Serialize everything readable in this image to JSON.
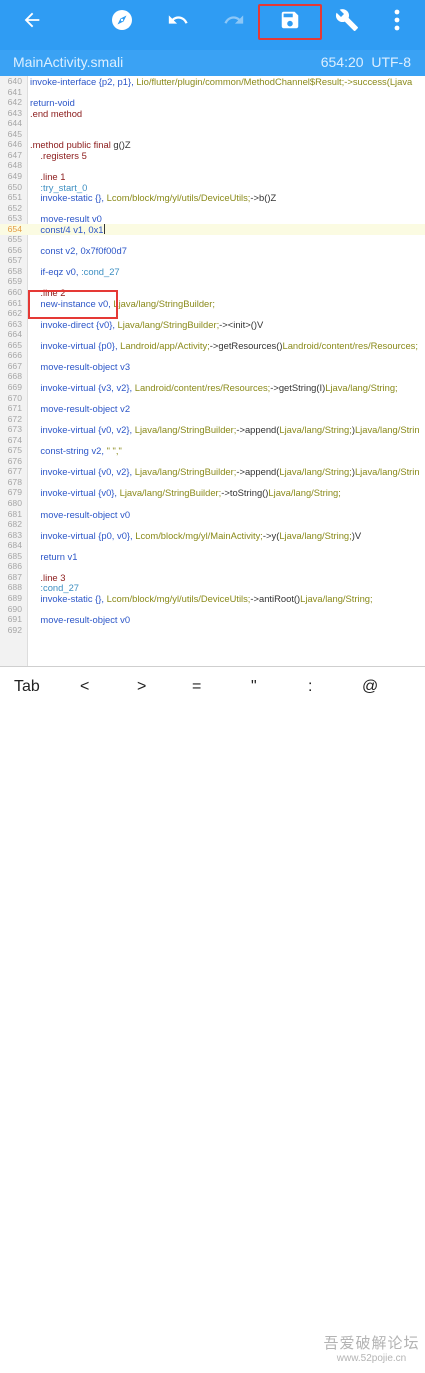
{
  "colors": {
    "toolbar": "#2f9cf3",
    "filebar": "#3aa2f4",
    "highlight": "#e53935",
    "keyword": "#2c56c8",
    "directive": "#8b1a1a",
    "label": "#3d8fc2",
    "type": "#8a8a1a"
  },
  "toolbar": {
    "icons": [
      "back-arrow-icon",
      "compass-icon",
      "undo-icon",
      "redo-icon",
      "save-icon",
      "wrench-icon",
      "more-vert-icon"
    ]
  },
  "file": {
    "name": "MainActivity.smali",
    "position": "654:20",
    "encoding": "UTF-8"
  },
  "lines": [
    {
      "num": "640",
      "tokens": [
        [
          "k-kw",
          "invoke-interface {p2, p1}, "
        ],
        [
          "k-str",
          "Lio/flutter/plugin/common/MethodChannel$Result;->success(Ljava"
        ]
      ]
    },
    {
      "num": "641",
      "tokens": []
    },
    {
      "num": "642",
      "tokens": [
        [
          "k-kw",
          "return-void"
        ]
      ]
    },
    {
      "num": "643",
      "tokens": [
        [
          "k-dir",
          ".end method"
        ]
      ]
    },
    {
      "num": "644",
      "tokens": []
    },
    {
      "num": "645",
      "tokens": []
    },
    {
      "num": "646",
      "tokens": [
        [
          "k-dir",
          ".method public final "
        ],
        [
          "k-plain",
          "g()Z"
        ]
      ]
    },
    {
      "num": "647",
      "tokens": [
        [
          "k-dir",
          "    .registers 5"
        ]
      ]
    },
    {
      "num": "648",
      "tokens": []
    },
    {
      "num": "649",
      "tokens": [
        [
          "k-dir",
          "    .line 1"
        ]
      ]
    },
    {
      "num": "650",
      "tokens": [
        [
          "k-lbl",
          "    :try_start_0"
        ]
      ]
    },
    {
      "num": "651",
      "tokens": [
        [
          "k-kw",
          "    invoke-static {}, "
        ],
        [
          "k-str",
          "Lcom/block/mg/yl/utils/DeviceUtils;"
        ],
        [
          "k-plain",
          "->b()Z"
        ]
      ]
    },
    {
      "num": "652",
      "tokens": []
    },
    {
      "num": "653",
      "tokens": [
        [
          "k-kw",
          "    move-result v0"
        ]
      ]
    },
    {
      "num": "654",
      "tokens": [
        [
          "k-kw",
          "    const/4 v1, 0x1"
        ]
      ],
      "current": true
    },
    {
      "num": "655",
      "tokens": []
    },
    {
      "num": "656",
      "tokens": [
        [
          "k-kw",
          "    const v2, 0x7f0f00d7"
        ]
      ]
    },
    {
      "num": "657",
      "tokens": []
    },
    {
      "num": "658",
      "tokens": [
        [
          "k-kw",
          "    if-eqz v0, "
        ],
        [
          "k-lbl",
          ":cond_27"
        ]
      ]
    },
    {
      "num": "659",
      "tokens": []
    },
    {
      "num": "660",
      "tokens": [
        [
          "k-dir",
          "    .line 2"
        ]
      ]
    },
    {
      "num": "661",
      "tokens": [
        [
          "k-kw",
          "    new-instance v0, "
        ],
        [
          "k-str",
          "Ljava/lang/StringBuilder;"
        ]
      ]
    },
    {
      "num": "662",
      "tokens": []
    },
    {
      "num": "663",
      "tokens": [
        [
          "k-kw",
          "    invoke-direct {v0}, "
        ],
        [
          "k-str",
          "Ljava/lang/StringBuilder;"
        ],
        [
          "k-plain",
          "-><init>()V"
        ]
      ]
    },
    {
      "num": "664",
      "tokens": []
    },
    {
      "num": "665",
      "tokens": [
        [
          "k-kw",
          "    invoke-virtual {p0}, "
        ],
        [
          "k-str",
          "Landroid/app/Activity;"
        ],
        [
          "k-plain",
          "->getResources()"
        ],
        [
          "k-str",
          "Landroid/content/res/Resources;"
        ]
      ]
    },
    {
      "num": "666",
      "tokens": []
    },
    {
      "num": "667",
      "tokens": [
        [
          "k-kw",
          "    move-result-object v3"
        ]
      ]
    },
    {
      "num": "668",
      "tokens": []
    },
    {
      "num": "669",
      "tokens": [
        [
          "k-kw",
          "    invoke-virtual {v3, v2}, "
        ],
        [
          "k-str",
          "Landroid/content/res/Resources;"
        ],
        [
          "k-plain",
          "->getString(I)"
        ],
        [
          "k-str",
          "Ljava/lang/String;"
        ]
      ]
    },
    {
      "num": "670",
      "tokens": []
    },
    {
      "num": "671",
      "tokens": [
        [
          "k-kw",
          "    move-result-object v2"
        ]
      ]
    },
    {
      "num": "672",
      "tokens": []
    },
    {
      "num": "673",
      "tokens": [
        [
          "k-kw",
          "    invoke-virtual {v0, v2}, "
        ],
        [
          "k-str",
          "Ljava/lang/StringBuilder;"
        ],
        [
          "k-plain",
          "->append("
        ],
        [
          "k-str",
          "Ljava/lang/String;"
        ],
        [
          "k-plain",
          ")"
        ],
        [
          "k-str",
          "Ljava/lang/Strin"
        ]
      ]
    },
    {
      "num": "674",
      "tokens": []
    },
    {
      "num": "675",
      "tokens": [
        [
          "k-kw",
          "    const-string v2, "
        ],
        [
          "k-str",
          "\" \",\""
        ]
      ]
    },
    {
      "num": "676",
      "tokens": []
    },
    {
      "num": "677",
      "tokens": [
        [
          "k-kw",
          "    invoke-virtual {v0, v2}, "
        ],
        [
          "k-str",
          "Ljava/lang/StringBuilder;"
        ],
        [
          "k-plain",
          "->append("
        ],
        [
          "k-str",
          "Ljava/lang/String;"
        ],
        [
          "k-plain",
          ")"
        ],
        [
          "k-str",
          "Ljava/lang/Strin"
        ]
      ]
    },
    {
      "num": "678",
      "tokens": []
    },
    {
      "num": "679",
      "tokens": [
        [
          "k-kw",
          "    invoke-virtual {v0}, "
        ],
        [
          "k-str",
          "Ljava/lang/StringBuilder;"
        ],
        [
          "k-plain",
          "->toString()"
        ],
        [
          "k-str",
          "Ljava/lang/String;"
        ]
      ]
    },
    {
      "num": "680",
      "tokens": []
    },
    {
      "num": "681",
      "tokens": [
        [
          "k-kw",
          "    move-result-object v0"
        ]
      ]
    },
    {
      "num": "682",
      "tokens": []
    },
    {
      "num": "683",
      "tokens": [
        [
          "k-kw",
          "    invoke-virtual {p0, v0}, "
        ],
        [
          "k-str",
          "Lcom/block/mg/yl/MainActivity;"
        ],
        [
          "k-plain",
          "->y("
        ],
        [
          "k-str",
          "Ljava/lang/String;"
        ],
        [
          "k-plain",
          ")V"
        ]
      ]
    },
    {
      "num": "684",
      "tokens": []
    },
    {
      "num": "685",
      "tokens": [
        [
          "k-kw",
          "    return v1"
        ]
      ]
    },
    {
      "num": "686",
      "tokens": []
    },
    {
      "num": "687",
      "tokens": [
        [
          "k-dir",
          "    .line 3"
        ]
      ]
    },
    {
      "num": "688",
      "tokens": [
        [
          "k-lbl",
          "    :cond_27"
        ]
      ]
    },
    {
      "num": "689",
      "tokens": [
        [
          "k-kw",
          "    invoke-static {}, "
        ],
        [
          "k-str",
          "Lcom/block/mg/yl/utils/DeviceUtils;"
        ],
        [
          "k-plain",
          "->antiRoot()"
        ],
        [
          "k-str",
          "Ljava/lang/String;"
        ]
      ]
    },
    {
      "num": "690",
      "tokens": []
    },
    {
      "num": "691",
      "tokens": [
        [
          "k-kw",
          "    move-result-object v0"
        ]
      ]
    },
    {
      "num": "692",
      "tokens": []
    }
  ],
  "symbols": [
    "Tab",
    "<",
    ">",
    "=",
    "\"",
    ":",
    "@"
  ],
  "watermark": {
    "line1": "吾爱破解论坛",
    "line2": "www.52pojie.cn"
  }
}
